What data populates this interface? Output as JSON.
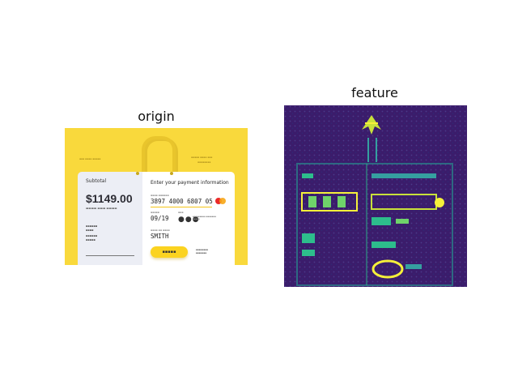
{
  "titles": {
    "origin": "origin",
    "feature": "feature"
  },
  "origin": {
    "subtotal_label": "Subtotal",
    "amount": "$1149.00",
    "heading": "Enter your payment information",
    "card_number": "3897 4000 6807 05",
    "expiry": "09/19",
    "cvv_dots": "●●●",
    "name": "SMITH"
  },
  "colors": {
    "background_yellow": "#f9d93c",
    "left_card": "#eceef5",
    "pay_button": "#fbd320",
    "feature_bg": "#3b1c6b",
    "feature_edge": "#2dbd8c",
    "feature_hot": "#f5f03a"
  }
}
